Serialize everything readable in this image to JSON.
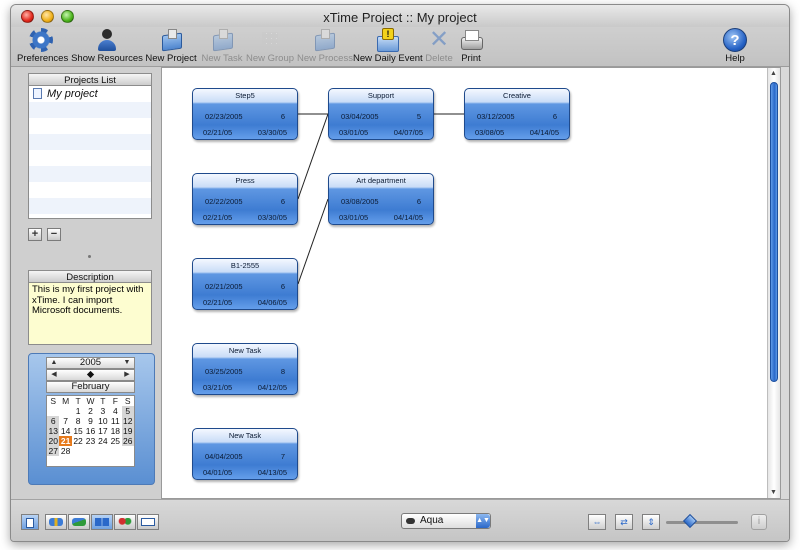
{
  "window": {
    "title": "xTime Project :: My project"
  },
  "toolbar": {
    "preferences": "Preferences",
    "show_resources": "Show Resources",
    "new_project": "New Project",
    "new_task": "New Task",
    "new_group": "New Group",
    "new_process": "New Process",
    "new_daily_event": "New Daily Event",
    "delete": "Delete",
    "print": "Print",
    "help": "Help",
    "help_glyph": "?"
  },
  "sidebar": {
    "projects_header": "Projects List",
    "projects": [
      {
        "name": "My project"
      }
    ],
    "add_glyph": "+",
    "remove_glyph": "−",
    "description_header": "Description",
    "description": "This is my first project with xTime. I can import Microsoft documents."
  },
  "calendar": {
    "year": "2005",
    "month": "February",
    "weekdays": [
      "S",
      "M",
      "T",
      "W",
      "T",
      "F",
      "S"
    ],
    "weeks": [
      [
        "",
        "",
        "1",
        "2",
        "3",
        "4",
        "5"
      ],
      [
        "6",
        "7",
        "8",
        "9",
        "10",
        "11",
        "12"
      ],
      [
        "13",
        "14",
        "15",
        "16",
        "17",
        "18",
        "19"
      ],
      [
        "20",
        "21",
        "22",
        "23",
        "24",
        "25",
        "26"
      ],
      [
        "27",
        "28",
        "",
        "",
        "",
        "",
        ""
      ]
    ],
    "today": "21"
  },
  "tasks": [
    {
      "id": "step5",
      "name": "Step5",
      "date": "02/23/2005",
      "count": "6",
      "start": "02/21/05",
      "end": "03/30/05"
    },
    {
      "id": "support",
      "name": "Support",
      "date": "03/04/2005",
      "count": "5",
      "start": "03/01/05",
      "end": "04/07/05"
    },
    {
      "id": "creative",
      "name": "Creative",
      "date": "03/12/2005",
      "count": "6",
      "start": "03/08/05",
      "end": "04/14/05"
    },
    {
      "id": "press",
      "name": "Press",
      "date": "02/22/2005",
      "count": "6",
      "start": "02/21/05",
      "end": "03/30/05"
    },
    {
      "id": "artdept",
      "name": "Art department",
      "date": "03/08/2005",
      "count": "6",
      "start": "03/01/05",
      "end": "04/14/05"
    },
    {
      "id": "b1",
      "name": "B1-2555",
      "date": "02/21/2005",
      "count": "6",
      "start": "02/21/05",
      "end": "04/06/05"
    },
    {
      "id": "newtask1",
      "name": "New Task",
      "date": "03/25/2005",
      "count": "8",
      "start": "03/21/05",
      "end": "04/12/05"
    },
    {
      "id": "newtask2",
      "name": "New Task",
      "date": "04/04/2005",
      "count": "7",
      "start": "04/01/05",
      "end": "04/13/05"
    }
  ],
  "links": [
    [
      "step5",
      "support"
    ],
    [
      "support",
      "creative"
    ],
    [
      "press",
      "support"
    ],
    [
      "b1",
      "artdept"
    ]
  ],
  "bottombar": {
    "style_value": "Aqua",
    "zoom_level": 0.3,
    "info_glyph": "i"
  },
  "colors": {
    "accent": "#3e7cd2",
    "today": "#e67a1c",
    "description_bg": "#fdfdd0"
  }
}
